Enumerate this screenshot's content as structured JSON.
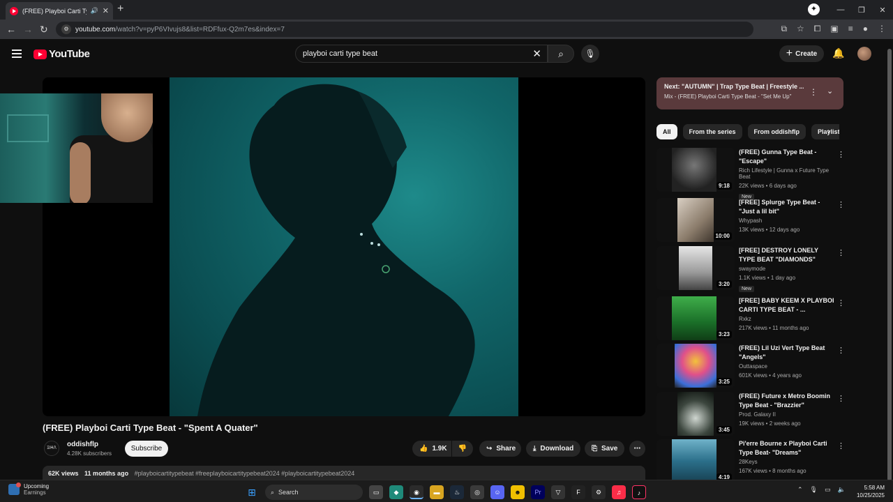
{
  "browser": {
    "tab_title": "(FREE) Playboi Carti Type Be",
    "new_tab": "+",
    "url_main": "youtube.com",
    "url_rest": "/watch?v=pyP6VIvujs8&list=RDFfux-Q2m7es&index=7",
    "win_min": "—",
    "win_max": "❐",
    "win_close": "✕"
  },
  "masthead": {
    "logo": "YouTube",
    "search_query": "playboi carti type beat",
    "create": "Create"
  },
  "video": {
    "title": "(FREE) Playboi Carti Type Beat - \"Spent A Quater\"",
    "channel": "oddishflp",
    "channel_avatar_text": "ᗫᕼᐱ",
    "subscribers": "4.28K subscribers",
    "subscribe": "Subscribe",
    "likes": "1.9K",
    "share": "Share",
    "download": "Download",
    "save": "Save",
    "views": "62K views",
    "age": "11 months ago",
    "tags": "#playboicartitypebeat #freeplayboicartitypebeat2024 #playboicartitypebeat2024"
  },
  "next_card": {
    "line1": "Next: \"AUTUMN\" | Trap Type Beat | Freestyle ...",
    "line2": "Mix - (FREE) Playboi Carti Type Beat - \"Set Me Up\""
  },
  "chips": [
    "All",
    "From the series",
    "From oddishflp",
    "Playlists"
  ],
  "recommendations": [
    {
      "title": "(FREE) Gunna Type Beat - \"Escape\"",
      "channel": "Rich Lifestyle | Gunna x Future Type Beat",
      "meta": "22K views • 6 days ago",
      "badge": "New",
      "duration": "9:18"
    },
    {
      "title": "[FREE] Splurge Type Beat - \"Just a lil bit\"",
      "channel": "Whypash",
      "meta": "13K views • 12 days ago",
      "badge": "",
      "duration": "10:00"
    },
    {
      "title": "[FREE] DESTROY LONELY TYPE BEAT \"DIAMONDS\"",
      "channel": "swaymode",
      "meta": "1.1K views • 1 day ago",
      "badge": "New",
      "duration": "3:20"
    },
    {
      "title": "[FREE] BABY KEEM X PLAYBOI CARTI TYPE BEAT - ...",
      "channel": "Rxkz",
      "meta": "217K views • 11 months ago",
      "badge": "",
      "duration": "3:23"
    },
    {
      "title": "(FREE) Lil Uzi Vert Type Beat \"Angels\"",
      "channel": "Outtaspace",
      "meta": "601K views • 4 years ago",
      "badge": "",
      "duration": "3:25"
    },
    {
      "title": "(FREE) Future x Metro Boomin Type Beat - \"Brazzier\"",
      "channel": "Prod. Galaxy II",
      "meta": "19K views • 2 weeks ago",
      "badge": "",
      "duration": "3:45"
    },
    {
      "title": "Pi'erre Bourne x Playboi Carti Type Beat- \"Dreams\"",
      "channel": "28Keys",
      "meta": "167K views • 8 months ago",
      "badge": "",
      "duration": "4:19"
    }
  ],
  "taskbar": {
    "weather_title": "Upcoming",
    "weather_sub": "Earnings",
    "search": "Search",
    "time": "5:58 AM",
    "date": "10/25/2025"
  }
}
